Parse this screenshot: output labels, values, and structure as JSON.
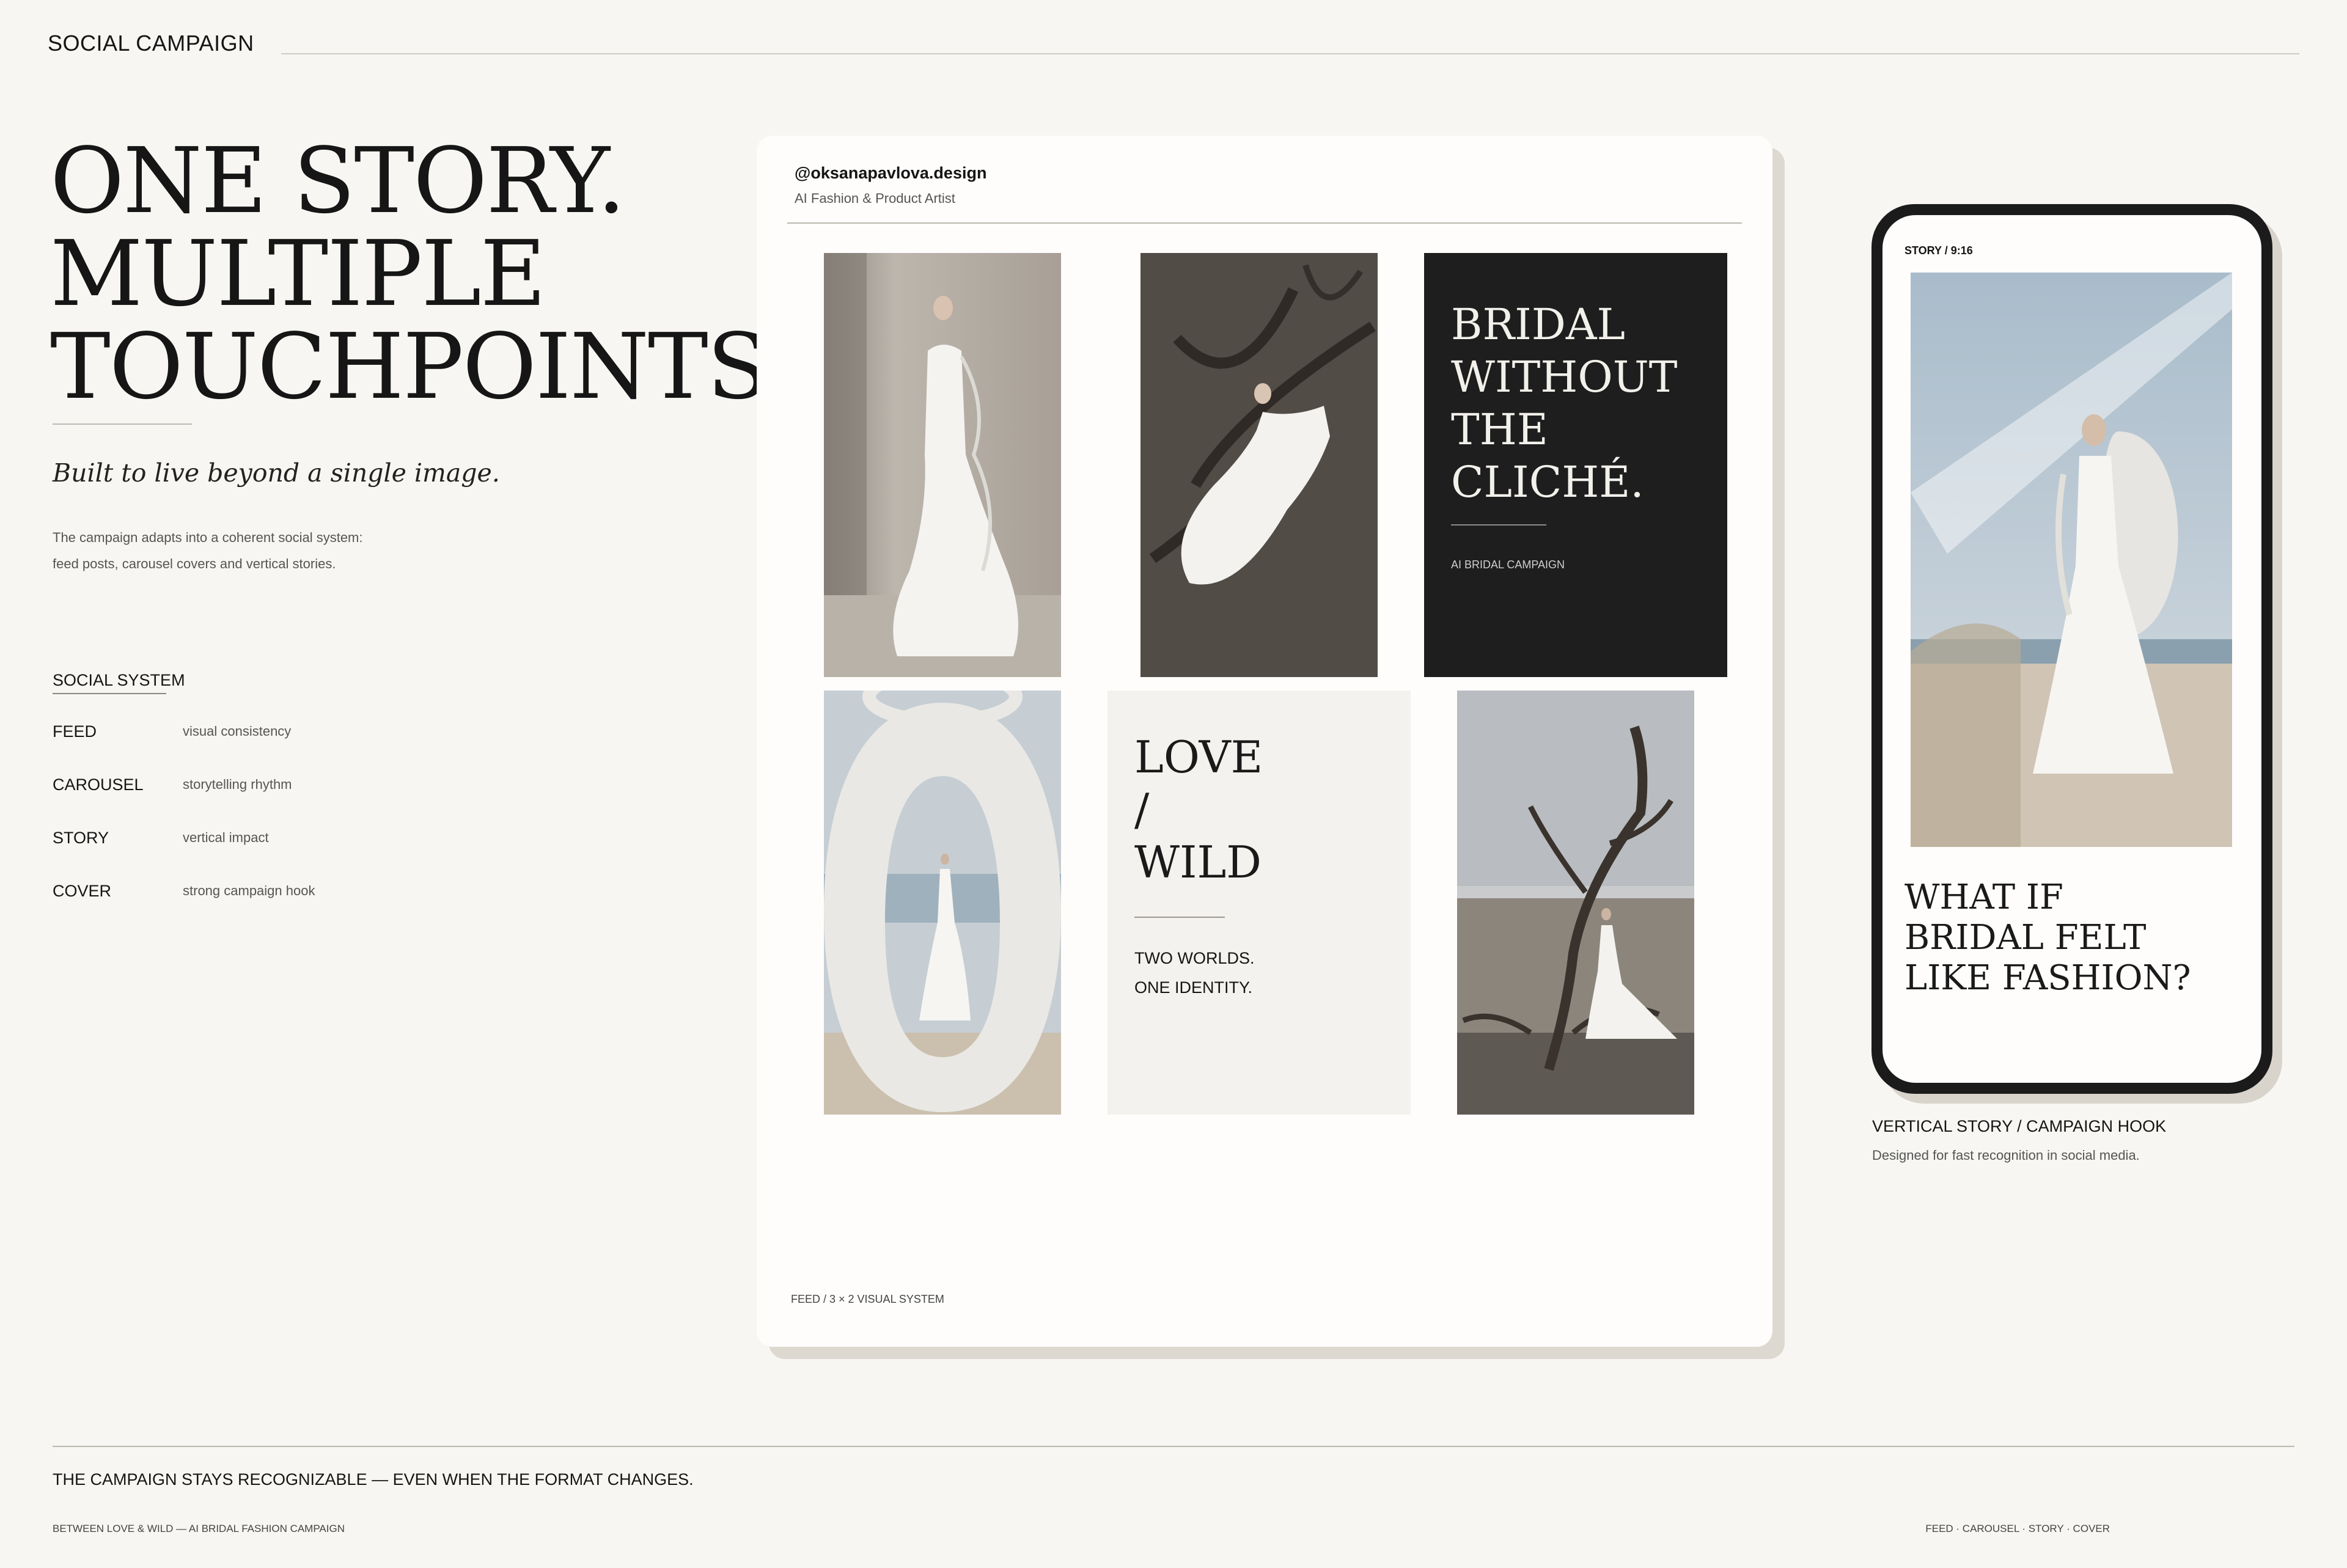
{
  "header": {
    "title": "SOCIAL CAMPAIGN"
  },
  "hero": {
    "title_lines": [
      "ONE STORY.",
      "MULTIPLE",
      "TOUCHPOINTS."
    ],
    "tagline": "Built to live beyond a single image.",
    "description_lines": [
      "The campaign adapts into a coherent social system:",
      "feed posts, carousel covers and vertical stories."
    ]
  },
  "system": {
    "heading": "SOCIAL SYSTEM",
    "items": [
      {
        "name": "FEED",
        "desc": "visual consistency"
      },
      {
        "name": "CAROUSEL",
        "desc": "storytelling rhythm"
      },
      {
        "name": "STORY",
        "desc": "vertical impact"
      },
      {
        "name": "COVER",
        "desc": "strong campaign hook"
      }
    ]
  },
  "feed": {
    "handle": "@oksanapavlova.design",
    "role": "AI Fashion & Product Artist",
    "tile_dark": {
      "title_lines": [
        "BRIDAL",
        "WITHOUT",
        "THE",
        "CLICHÉ."
      ],
      "subtitle": "AI BRIDAL CAMPAIGN"
    },
    "tile_text": {
      "title_lines": [
        "LOVE",
        "/",
        "WILD"
      ],
      "subtitle_lines": [
        "TWO WORLDS.",
        "ONE IDENTITY."
      ]
    },
    "footer": "FEED / 3 × 2 VISUAL SYSTEM"
  },
  "story": {
    "label": "STORY / 9:16",
    "headline_lines": [
      "WHAT IF",
      "BRIDAL FELT",
      "LIKE FASHION?"
    ],
    "caption": "VERTICAL STORY / CAMPAIGN HOOK",
    "caption_sub": "Designed for fast recognition in social media."
  },
  "footer": {
    "statement": "THE CAMPAIGN STAYS RECOGNIZABLE — EVEN WHEN THE FORMAT CHANGES.",
    "left": "BETWEEN LOVE & WILD  —  AI BRIDAL FASHION CAMPAIGN",
    "right": "FEED  ·  CAROUSEL  ·  STORY  ·  COVER"
  },
  "colors": {
    "background": "#f7f6f2",
    "board": "#fefdfb",
    "dark_tile": "#1e1e1e",
    "ink": "#151515"
  }
}
